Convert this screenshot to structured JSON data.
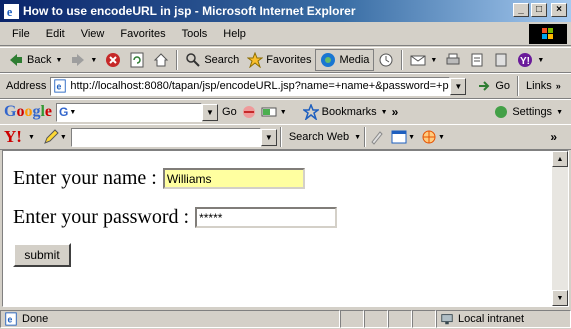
{
  "window": {
    "title": "How to use encodeURL in jsp - Microsoft Internet Explorer"
  },
  "menu": [
    "File",
    "Edit",
    "View",
    "Favorites",
    "Tools",
    "Help"
  ],
  "toolbar": {
    "back": "Back",
    "search": "Search",
    "favorites": "Favorites",
    "media": "Media"
  },
  "address": {
    "label": "Address",
    "url": "http://localhost:8080/tapan/jsp/encodeURL.jsp?name=+name+&password=+p",
    "go": "Go",
    "links": "Links"
  },
  "google_bar": {
    "go": "Go",
    "bookmarks": "Bookmarks",
    "settings": "Settings"
  },
  "yahoo_bar": {
    "search_web": "Search Web"
  },
  "page": {
    "name_label": "Enter your name :",
    "name_value": "Williams",
    "password_label": "Enter your password :",
    "password_value": "*****",
    "submit_label": "submit"
  },
  "status": {
    "text": "Done",
    "zone": "Local intranet"
  }
}
